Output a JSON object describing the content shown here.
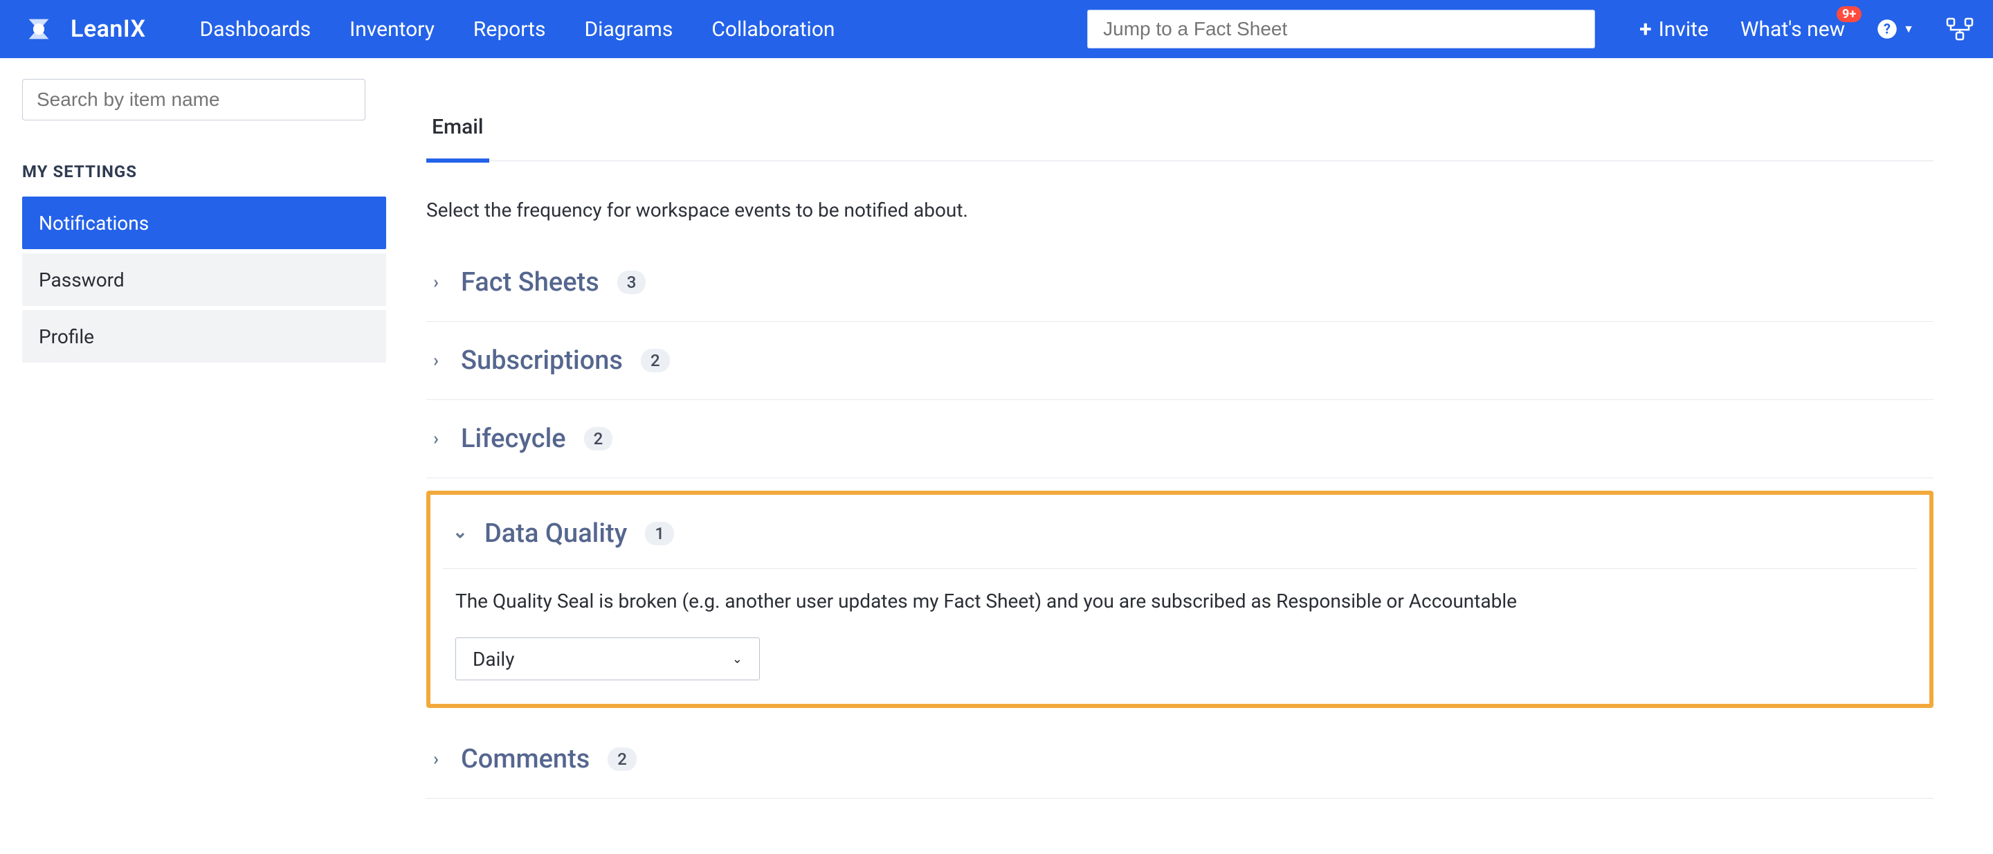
{
  "brand": {
    "name": "LeanIX"
  },
  "nav": {
    "items": [
      "Dashboards",
      "Inventory",
      "Reports",
      "Diagrams",
      "Collaboration"
    ],
    "jump_placeholder": "Jump to a Fact Sheet",
    "invite": "Invite",
    "whats_new": "What's new",
    "badge": "9+"
  },
  "sidebar": {
    "search_placeholder": "Search by item name",
    "heading": "MY SETTINGS",
    "items": [
      {
        "label": "Notifications",
        "selected": true
      },
      {
        "label": "Password",
        "selected": false
      },
      {
        "label": "Profile",
        "selected": false
      }
    ]
  },
  "main": {
    "tabs": [
      {
        "label": "Email",
        "active": true
      }
    ],
    "lead": "Select the frequency for workspace events to be notified about.",
    "sections": [
      {
        "title": "Fact Sheets",
        "count": "3",
        "expanded": false
      },
      {
        "title": "Subscriptions",
        "count": "2",
        "expanded": false
      },
      {
        "title": "Lifecycle",
        "count": "2",
        "expanded": false
      },
      {
        "title": "Data Quality",
        "count": "1",
        "expanded": true,
        "desc": "The Quality Seal is broken (e.g. another user updates my Fact Sheet) and you are subscribed as Responsible or Accountable",
        "frequency": "Daily",
        "highlighted": true
      },
      {
        "title": "Comments",
        "count": "2",
        "expanded": false
      }
    ]
  }
}
